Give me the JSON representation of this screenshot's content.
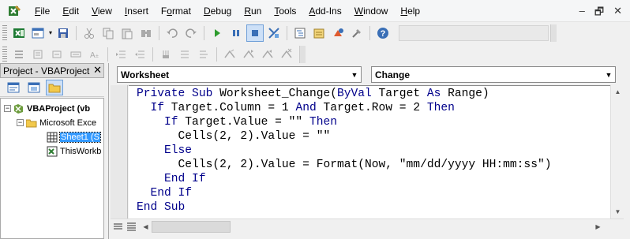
{
  "menubar": {
    "items": [
      {
        "label": "File",
        "u": "F",
        "rest": "ile"
      },
      {
        "label": "Edit",
        "u": "E",
        "rest": "dit"
      },
      {
        "label": "View",
        "u": "V",
        "rest": "iew"
      },
      {
        "label": "Insert",
        "u": "I",
        "rest": "nsert"
      },
      {
        "label": "Format",
        "u": "o",
        "pre": "F",
        "rest": "rmat"
      },
      {
        "label": "Debug",
        "u": "D",
        "rest": "ebug"
      },
      {
        "label": "Run",
        "u": "R",
        "rest": "un"
      },
      {
        "label": "Tools",
        "u": "T",
        "rest": "ools"
      },
      {
        "label": "Add-Ins",
        "u": "A",
        "rest": "dd-Ins"
      },
      {
        "label": "Window",
        "u": "W",
        "rest": "indow"
      },
      {
        "label": "Help",
        "u": "H",
        "rest": "elp"
      }
    ],
    "window_controls": {
      "minimize": "‒",
      "restore": "🗗",
      "close": "✕"
    }
  },
  "project_pane": {
    "title": "Project - VBAProject",
    "close": "✕",
    "tree": {
      "root": "VBAProject (vb",
      "root_expander": "−",
      "folder": "Microsoft Exce",
      "folder_expander": "−",
      "sheet": "Sheet1 (S",
      "workbook": "ThisWorkb"
    }
  },
  "code_window": {
    "object_combo": "Worksheet",
    "procedure_combo": "Change",
    "lines": [
      [
        {
          "t": "Private Sub ",
          "kw": true
        },
        {
          "t": "Worksheet_Change("
        },
        {
          "t": "ByVal",
          "kw": true
        },
        {
          "t": " Target "
        },
        {
          "t": "As",
          "kw": true
        },
        {
          "t": " Range)"
        }
      ],
      [
        {
          "t": "  "
        },
        {
          "t": "If",
          "kw": true
        },
        {
          "t": " Target.Column = 1 "
        },
        {
          "t": "And",
          "kw": true
        },
        {
          "t": " Target.Row = 2 "
        },
        {
          "t": "Then",
          "kw": true
        }
      ],
      [
        {
          "t": "    "
        },
        {
          "t": "If",
          "kw": true
        },
        {
          "t": " Target.Value = \"\" "
        },
        {
          "t": "Then",
          "kw": true
        }
      ],
      [
        {
          "t": "      Cells(2, 2).Value = \"\""
        }
      ],
      [
        {
          "t": "    "
        },
        {
          "t": "Else",
          "kw": true
        }
      ],
      [
        {
          "t": "      Cells(2, 2).Value = Format(Now, \"mm/dd/yyyy HH:mm:ss\")"
        }
      ],
      [
        {
          "t": "    "
        },
        {
          "t": "End If",
          "kw": true
        }
      ],
      [
        {
          "t": "  "
        },
        {
          "t": "End If",
          "kw": true
        }
      ],
      [
        {
          "t": "End Sub",
          "kw": true
        }
      ]
    ]
  },
  "colors": {
    "keyword": "#00008b",
    "selection": "#3399ff",
    "pressed_button": "#cde0f7"
  },
  "icons": {
    "toolbar1": [
      "excel-view-icon",
      "insert-userform-icon",
      "save-icon",
      "cut-icon",
      "copy-icon",
      "paste-icon",
      "find-icon",
      "undo-icon",
      "redo-icon",
      "run-icon",
      "break-icon",
      "reset-icon",
      "design-mode-icon",
      "project-explorer-icon",
      "properties-icon",
      "object-browser-icon",
      "toolbox-icon",
      "help-icon"
    ],
    "toolbar2": [
      "list-properties-icon",
      "list-constants-icon",
      "quick-info-icon",
      "parameter-info-icon",
      "complete-word-icon",
      "indent-icon",
      "outdent-icon",
      "toggle-breakpoint-icon",
      "comment-block-icon",
      "uncomment-block-icon",
      "toggle-bookmark-icon",
      "next-bookmark-icon",
      "previous-bookmark-icon",
      "clear-bookmarks-icon"
    ]
  }
}
